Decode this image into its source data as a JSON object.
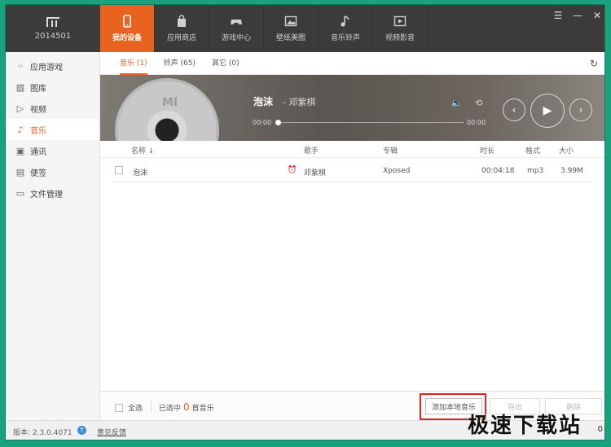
{
  "topbar": {
    "device_name": "2014501",
    "tabs": [
      {
        "label": "我的设备",
        "icon": "phone-icon",
        "active": true
      },
      {
        "label": "应用商店",
        "icon": "bag-icon",
        "active": false
      },
      {
        "label": "游戏中心",
        "icon": "gamepad-icon",
        "active": false
      },
      {
        "label": "壁纸美图",
        "icon": "picture-icon",
        "active": false
      },
      {
        "label": "音乐铃声",
        "icon": "music-note-icon",
        "active": false
      },
      {
        "label": "视频影音",
        "icon": "video-icon",
        "active": false
      }
    ],
    "window_controls": [
      "menu-icon",
      "minimize-icon",
      "close-icon"
    ]
  },
  "sidebar": {
    "items": [
      {
        "label": "应用游戏",
        "icon": "apps-icon"
      },
      {
        "label": "图库",
        "icon": "image-icon"
      },
      {
        "label": "视频",
        "icon": "play-icon"
      },
      {
        "label": "音乐",
        "icon": "music-icon",
        "active": true
      },
      {
        "label": "通讯",
        "icon": "contacts-icon"
      },
      {
        "label": "便签",
        "icon": "note-icon"
      },
      {
        "label": "文件管理",
        "icon": "folder-icon"
      }
    ]
  },
  "subtabs": [
    {
      "label": "音乐 (1)",
      "active": true
    },
    {
      "label": "铃声 (65)",
      "active": false
    },
    {
      "label": "其它 (0)",
      "active": false
    }
  ],
  "player": {
    "song": "泡沫",
    "artist": "- 邓紫棋",
    "time_elapsed": "00:00",
    "time_total": "00:00",
    "progress": 0
  },
  "table": {
    "headers": {
      "name": "名称",
      "artist": "歌手",
      "album": "专辑",
      "duration": "时长",
      "format": "格式",
      "size": "大小"
    },
    "rows": [
      {
        "name": "泡沫",
        "artist": "邓紫棋",
        "album": "Xposed",
        "duration": "00:04:18",
        "format": "mp3",
        "size": "3.99M"
      }
    ]
  },
  "footer": {
    "select_all": "全选",
    "selected_prefix": "已选中",
    "selected_count": "0",
    "selected_suffix": "首音乐",
    "add_button": "添加本地音乐",
    "export_button": "导出",
    "delete_button": "删除"
  },
  "status": {
    "version": "版本: 2.3.0.4071",
    "feedback": "意见反馈",
    "right_text": "0"
  },
  "watermark": "极速下载站",
  "colors": {
    "accent": "#e9621f",
    "highlight_box": "#dd2222"
  }
}
